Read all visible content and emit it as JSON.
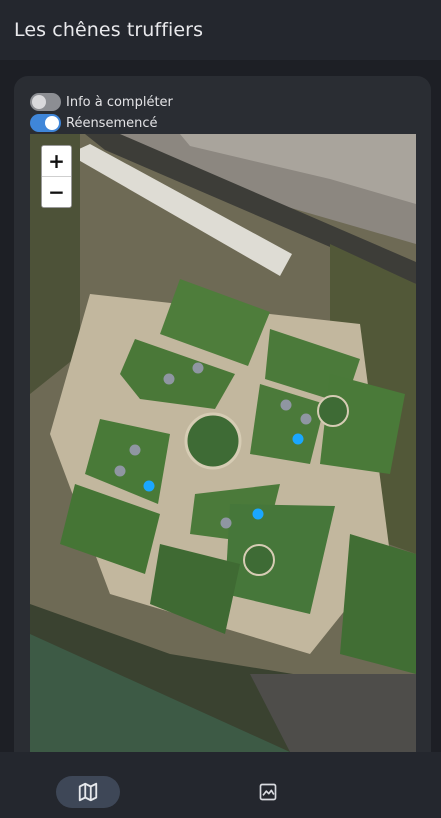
{
  "header": {
    "title": "Les chênes truffiers"
  },
  "toggles": [
    {
      "label": "Info à compléter",
      "on": false
    },
    {
      "label": "Réensemencé",
      "on": true
    }
  ],
  "map": {
    "zoom_in_label": "+",
    "zoom_out_label": "−",
    "tree_colors": {
      "complete": "#1aa7ff",
      "incomplete": "#8f96a2"
    }
  },
  "bottom_nav": {
    "items": [
      {
        "icon": "map-icon",
        "active": true
      },
      {
        "icon": "image-icon",
        "active": false
      }
    ]
  }
}
